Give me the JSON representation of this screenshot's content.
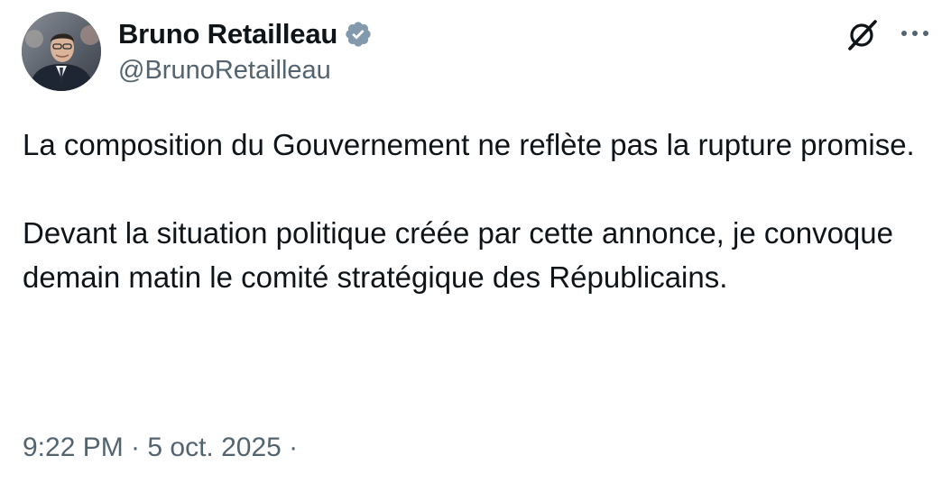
{
  "author": {
    "display_name": "Bruno Retailleau",
    "handle": "@BrunoRetailleau",
    "verified": true,
    "verified_color": "#829aab"
  },
  "header_actions": {
    "grok_icon": "grok-slash-circle-icon",
    "more_icon": "more-dots-icon"
  },
  "tweet": {
    "paragraphs": [
      "La composition du Gouvernement ne reflète pas la rupture promise.",
      "Devant la situation politique créée par cette annonce, je convoque demain matin le comité stratégique des Républicains."
    ],
    "timestamp": "9:22 PM · 5 oct. 2025 ·"
  },
  "colors": {
    "text_primary": "#0f1419",
    "text_secondary": "#536471"
  }
}
